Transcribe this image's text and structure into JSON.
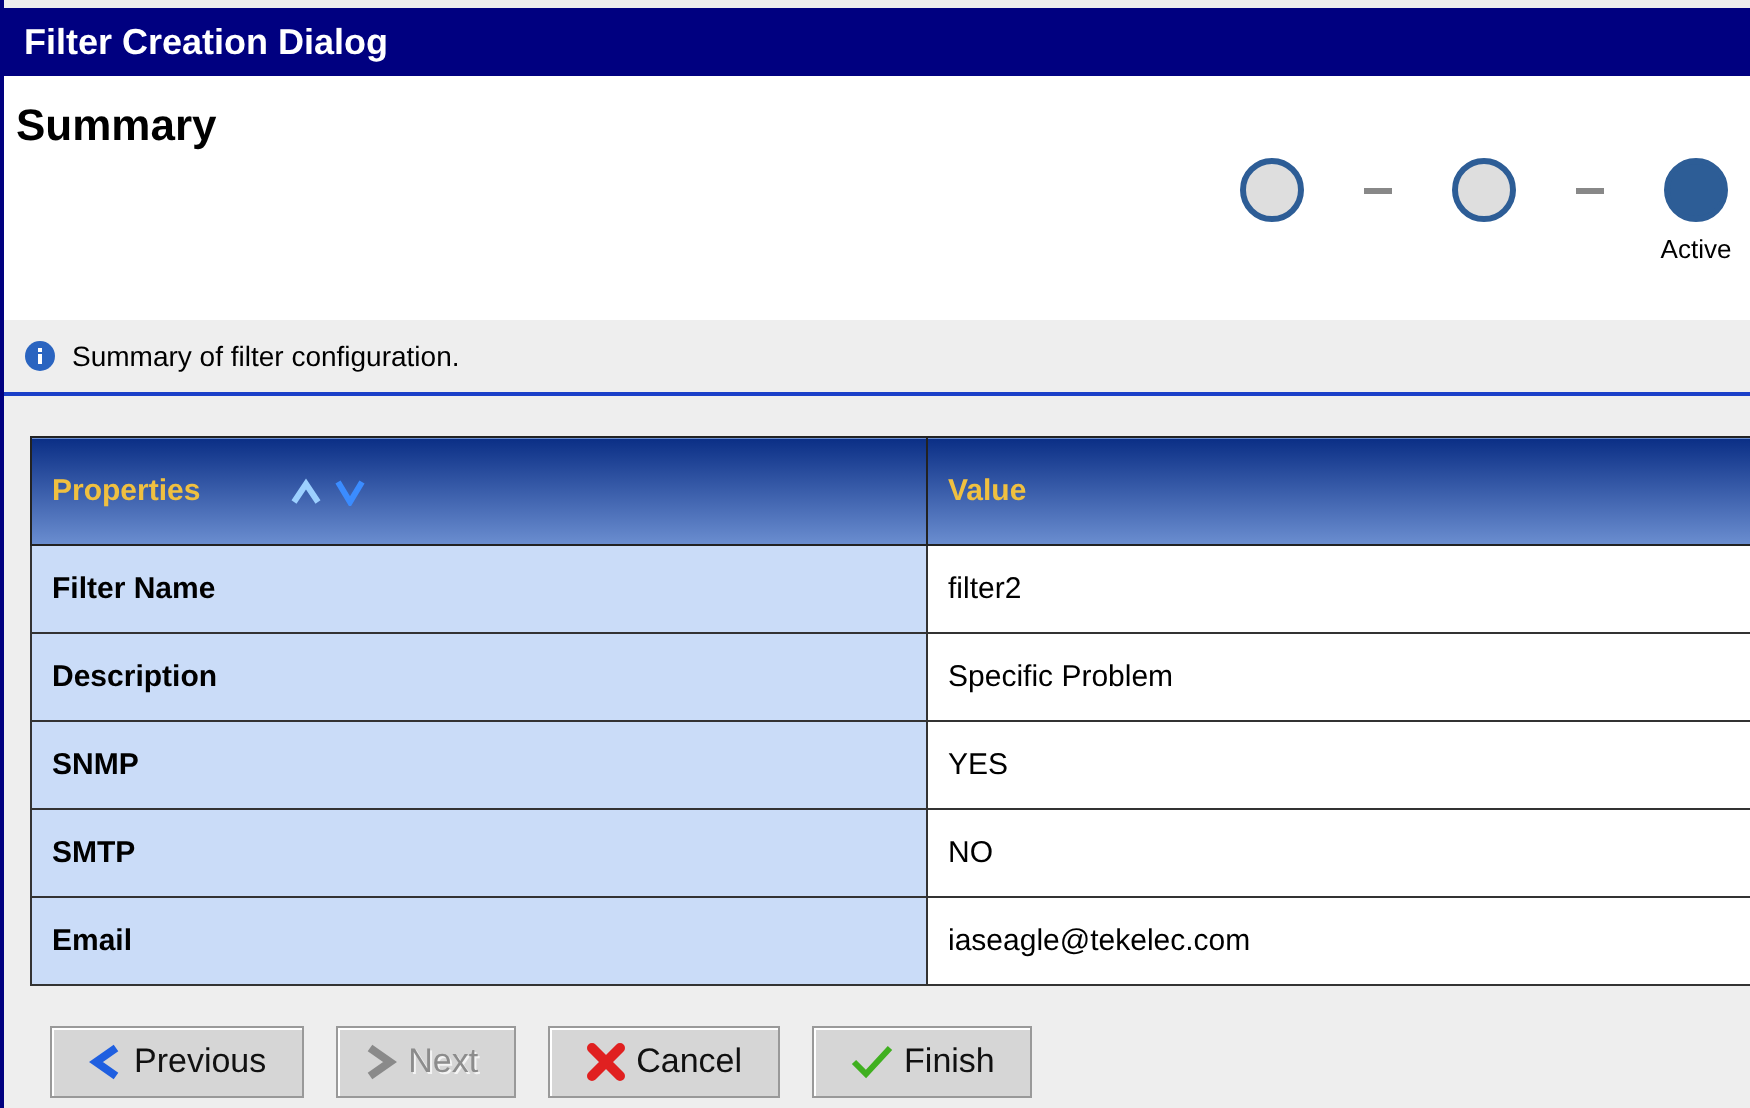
{
  "window": {
    "title": "Filter Creation Dialog"
  },
  "page": {
    "heading": "Summary",
    "info": "Summary of filter configuration."
  },
  "steps": [
    {
      "selected": false
    },
    {
      "selected": false
    },
    {
      "selected": true,
      "label": "Active"
    }
  ],
  "table": {
    "columns": [
      "Properties",
      "Value"
    ],
    "rows": [
      {
        "property": "Filter Name",
        "value": "filter2"
      },
      {
        "property": "Description",
        "value": "Specific Problem"
      },
      {
        "property": "SNMP",
        "value": "YES"
      },
      {
        "property": "SMTP",
        "value": "NO"
      },
      {
        "property": "Email",
        "value": "iaseagle@tekelec.com"
      }
    ]
  },
  "buttons": [
    {
      "kind": "previous",
      "label": "Previous",
      "disabled": false
    },
    {
      "kind": "next",
      "label": "Next",
      "disabled": true
    },
    {
      "kind": "cancel",
      "label": "Cancel",
      "disabled": false
    },
    {
      "kind": "finish",
      "label": "Finish",
      "disabled": false
    }
  ]
}
